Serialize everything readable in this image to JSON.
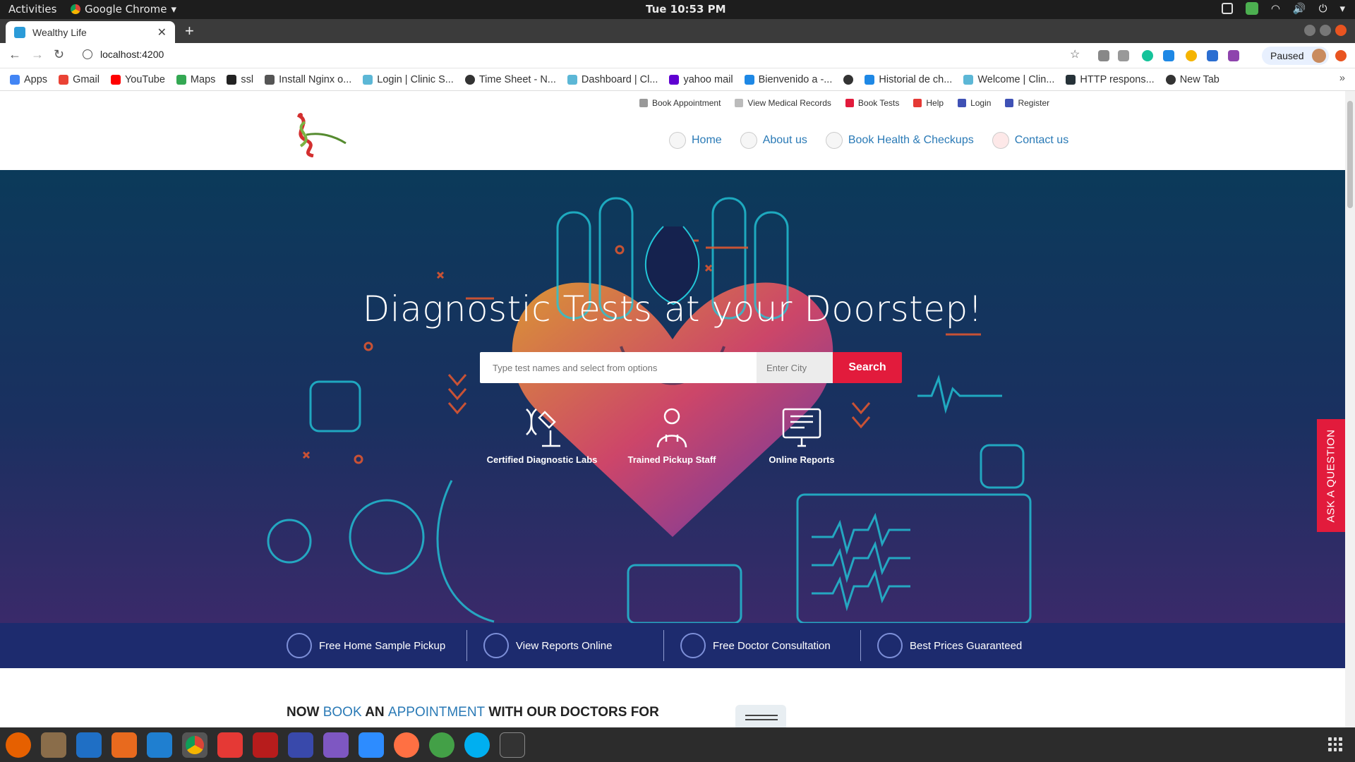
{
  "gnome": {
    "activities": "Activities",
    "app_name": "Google Chrome",
    "clock": "Tue 10:53 PM"
  },
  "browser": {
    "tab_title": "Wealthy Life",
    "url": "localhost:4200",
    "profile_status": "Paused",
    "bookmarks": [
      "Apps",
      "Gmail",
      "YouTube",
      "Maps",
      "ssl",
      "Install Nginx o...",
      "Login | Clinic S...",
      "Time Sheet - N...",
      "Dashboard | Cl...",
      "yahoo mail",
      "Bienvenido a -...",
      "Historial de ch...",
      "Welcome | Clin...",
      "HTTP respons...",
      "New Tab"
    ]
  },
  "site": {
    "top_links": [
      "Book Appointment",
      "View Medical Records",
      "Book Tests",
      "Help",
      "Login",
      "Register"
    ],
    "nav": [
      "Home",
      "About us",
      "Book Health & Checkups",
      "Contact us"
    ],
    "hero_title": "Diagnostic Tests at your Doorstep!",
    "search_placeholder": "Type test names and select from options",
    "city_placeholder": "Enter City",
    "search_button": "Search",
    "features": [
      "Certified Diagnostic Labs",
      "Trained Pickup Staff",
      "Online Reports"
    ],
    "ask_question": "ASK A QUESTION",
    "band": [
      "Free Home Sample Pickup",
      "View Reports Online",
      "Free Doctor Consultation",
      "Best Prices Guaranteed"
    ],
    "book_line": {
      "p1": "NOW ",
      "p2": "BOOK",
      "p3": " AN ",
      "p4": "APPOINTMENT",
      "p5": " WITH OUR DOCTORS FOR"
    }
  },
  "colors": {
    "accent_red": "#e21b3c",
    "link_blue": "#2a7ab6",
    "band_navy": "#1d2b6e"
  }
}
